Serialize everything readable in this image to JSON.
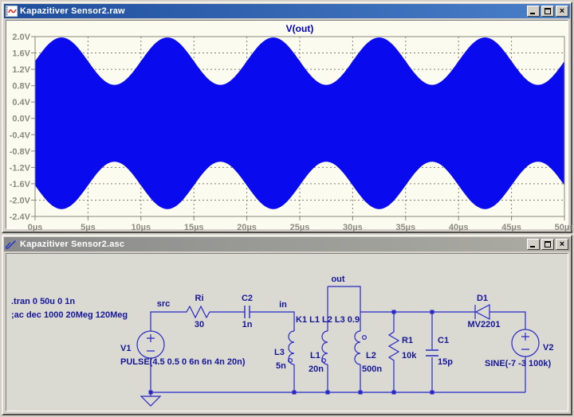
{
  "plot_window": {
    "title": "Kapazitiver Sensor2.raw",
    "icons": {
      "close_glyph": "×"
    }
  },
  "schematic_window": {
    "title": "Kapazitiver Sensor2.asc",
    "icons": {
      "close_glyph": "×"
    }
  },
  "chart_data": {
    "type": "area",
    "title": "V(out)",
    "x_ticks": [
      "0µs",
      "5µs",
      "10µs",
      "15µs",
      "20µs",
      "25µs",
      "30µs",
      "35µs",
      "40µs",
      "45µs",
      "50µs"
    ],
    "x_tick_values": [
      0,
      5,
      10,
      15,
      20,
      25,
      30,
      35,
      40,
      45,
      50
    ],
    "y_ticks": [
      "2.0V",
      "1.6V",
      "1.2V",
      "0.8V",
      "0.4V",
      "0.0V",
      "-0.4V",
      "-0.8V",
      "-1.2V",
      "-1.6V",
      "-2.0V",
      "-2.4V"
    ],
    "y_tick_values": [
      2.0,
      1.6,
      1.2,
      0.8,
      0.4,
      0.0,
      -0.4,
      -0.8,
      -1.2,
      -1.6,
      -2.0,
      -2.4
    ],
    "xlim": [
      0,
      50
    ],
    "ylim": [
      -2.4,
      2.0
    ],
    "x_unit": "µs",
    "grid": true,
    "trace_color": "#0A0AEE",
    "title_color": "#0000C8",
    "axis_label_color": "#8A8A80",
    "description": "20MHz carrier amplitude-modulated at 100kHz, solid fill between envelopes",
    "envelope": {
      "center_v": -0.12,
      "mean_amplitude_v": 1.52,
      "mod_depth_v": 0.58,
      "mod_period_us": 10,
      "peak_time_us": 2.5
    }
  },
  "schematic": {
    "directives": [
      ".tran 0 50u 0 1n",
      ";ac dec 1000 20Meg 120Meg"
    ],
    "coupling": "K1 L1 L2 L3 0.9",
    "nets": [
      "src",
      "in",
      "out"
    ],
    "components": [
      {
        "ref": "V1",
        "value": "PULSE(4.5 0.5 0 6n 6n 4n 20n)",
        "type": "voltage-source"
      },
      {
        "ref": "Ri",
        "value": "30",
        "type": "resistor"
      },
      {
        "ref": "C2",
        "value": "1n",
        "type": "capacitor"
      },
      {
        "ref": "L3",
        "value": "5n",
        "type": "inductor"
      },
      {
        "ref": "L1",
        "value": "20n",
        "type": "inductor"
      },
      {
        "ref": "L2",
        "value": "500n",
        "type": "inductor"
      },
      {
        "ref": "R1",
        "value": "10k",
        "type": "resistor"
      },
      {
        "ref": "C1",
        "value": "15p",
        "type": "capacitor"
      },
      {
        "ref": "D1",
        "value": "MV2201",
        "type": "diode"
      },
      {
        "ref": "V2",
        "value": "SINE(-7 -3 100k)",
        "type": "voltage-source"
      }
    ],
    "colors": {
      "wire": "#2828C8",
      "text": "#16169A",
      "bg": "#DADAD2"
    }
  }
}
